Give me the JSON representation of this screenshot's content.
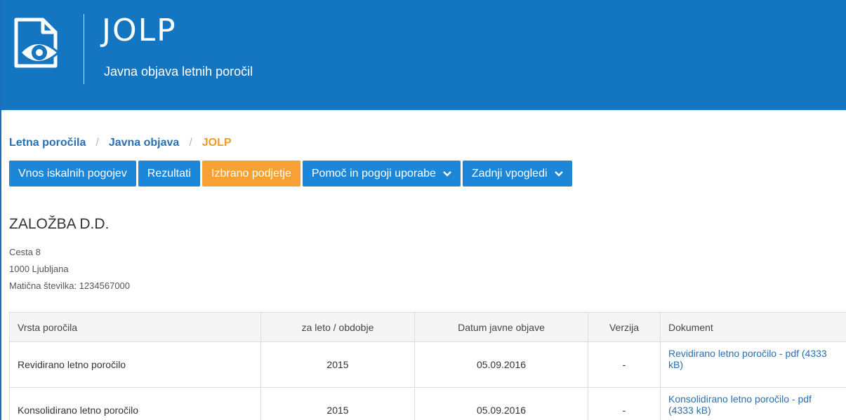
{
  "header": {
    "title": "JOLP",
    "subtitle": "Javna objava letnih poročil",
    "logo_icon": "document-eye-icon"
  },
  "breadcrumb": {
    "items": [
      "Letna poročila",
      "Javna objava"
    ],
    "current": "JOLP",
    "separator": "/"
  },
  "tabs": [
    {
      "label": "Vnos iskalnih pogojev",
      "active": false
    },
    {
      "label": "Rezultati",
      "active": false
    },
    {
      "label": "Izbrano podjetje",
      "active": true
    },
    {
      "label": "Pomoč in pogoji uporabe",
      "active": false,
      "dropdown": true
    },
    {
      "label": "Zadnji vpogledi",
      "active": false,
      "dropdown": true
    }
  ],
  "company": {
    "name": "ZALOŽBA D.D.",
    "street": "Cesta 8",
    "city": "1000 Ljubljana",
    "registration": "Matična številka: 1234567000"
  },
  "table": {
    "headers": [
      "Vrsta poročila",
      "za leto / obdobje",
      "Datum javne objave",
      "Verzija",
      "Dokument"
    ],
    "rows": [
      {
        "type": "Revidirano letno poročilo",
        "year": "2015",
        "date": "05.09.2016",
        "version": "-",
        "document": "Revidirano letno poročilo - pdf (4333 kB)"
      },
      {
        "type": "Konsolidirano letno poročilo",
        "year": "2015",
        "date": "05.09.2016",
        "version": "-",
        "document": "Konsolidirano letno poročilo - pdf (4333 kB)"
      }
    ]
  },
  "colors": {
    "header_bg": "#1475c1",
    "tab_bg": "#1c86d8",
    "tab_active_bg": "#f7a135",
    "link": "#2a6fb0",
    "breadcrumb_current": "#f39a24"
  }
}
